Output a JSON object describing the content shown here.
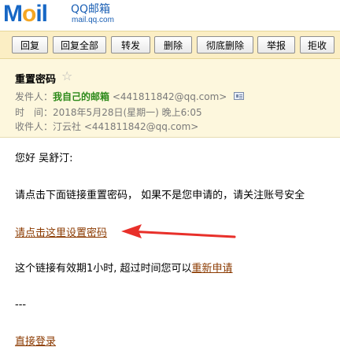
{
  "brand": {
    "logo_m": "M",
    "logo_o": "o",
    "logo_il": "il",
    "qq_text": "QQ邮箱",
    "domain": "mail.qq.com"
  },
  "toolbar": {
    "buttons": [
      "回复",
      "回复全部",
      "转发",
      "删除",
      "彻底删除",
      "举报",
      "拒收"
    ]
  },
  "mail": {
    "subject": "重置密码",
    "star": "☆",
    "sender_label": "发件人：",
    "sender_name": "我自己的邮箱",
    "sender_email": "<441811842@qq.com>",
    "time_label": "时　间：",
    "time_value": "2018年5月28日(星期一) 晚上6:05",
    "recipient_label": "收件人：",
    "recipient_name": "汀云社",
    "recipient_email": "<441811842@qq.com>"
  },
  "content": {
    "greeting": "您好 吴舒汀:",
    "instruction": "请点击下面链接重置密码， 如果不是您申请的，请关注账号安全",
    "reset_link": "请点击这里设置密码",
    "validity_prefix": "这个链接有效期1小时, 超过时间您可以",
    "reapply_link": "重新申请",
    "separator": "---",
    "login_link": "直接登录"
  },
  "colors": {
    "toolbar_bg": "#fbeec4",
    "header_bg": "#fdf7dd",
    "sender_green": "#2d8a1a",
    "link_brown": "#8b3a00",
    "arrow_red": "#e8302a"
  }
}
